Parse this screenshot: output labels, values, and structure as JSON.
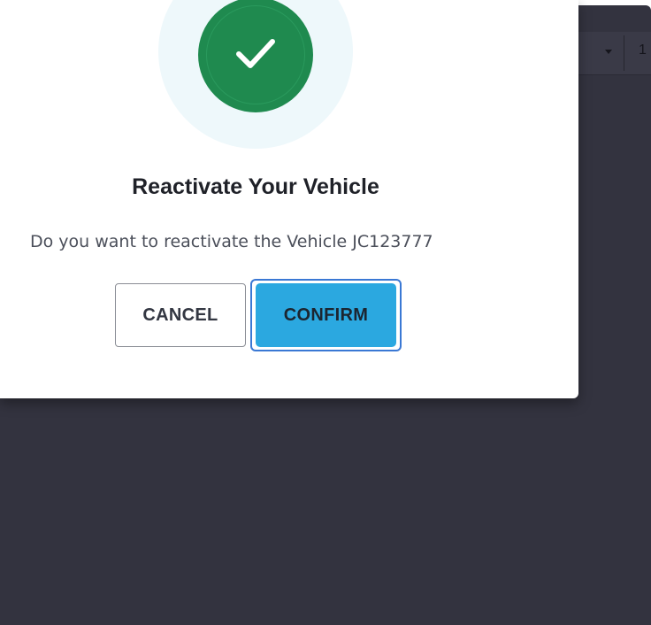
{
  "background_app": {
    "toolbar_value": "1"
  },
  "dialog": {
    "title": "Reactivate Your Vehicle",
    "message": "Do you want to reactivate the Vehicle JC123777",
    "cancel_label": "CANCEL",
    "confirm_label": "CONFIRM",
    "status_icon": "checkmark-icon"
  },
  "colors": {
    "success_green": "#1f8a4f",
    "halo": "#eef8fb",
    "confirm_blue": "#2ba8e0",
    "focus_ring": "#3a78d4",
    "backdrop": "#33333f"
  }
}
